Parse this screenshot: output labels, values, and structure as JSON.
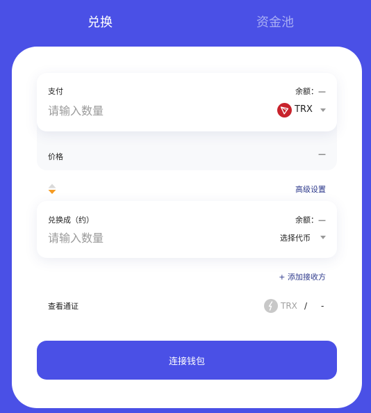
{
  "tabs": [
    {
      "label": "兑换",
      "active": true
    },
    {
      "label": "资金池",
      "active": false
    }
  ],
  "pay": {
    "label": "支付",
    "balance_label": "余额：",
    "balance_value": "—",
    "placeholder": "请输入数量",
    "token": "TRX"
  },
  "price": {
    "label": "价格",
    "value": "—"
  },
  "advanced_label": "高级设置",
  "receive": {
    "label": "兑换成（约）",
    "balance_label": "余额：",
    "balance_value": "—",
    "placeholder": "请输入数量",
    "token_select": "选择代币"
  },
  "add_recipient": "+ 添加接收方",
  "pass": {
    "label": "查看通证",
    "token": "TRX",
    "separator": "/",
    "value": "-"
  },
  "connect_label": "连接钱包",
  "colors": {
    "brand": "#4a50e6",
    "trx_red": "#c8232c",
    "swap_orange": "#f59b23"
  }
}
